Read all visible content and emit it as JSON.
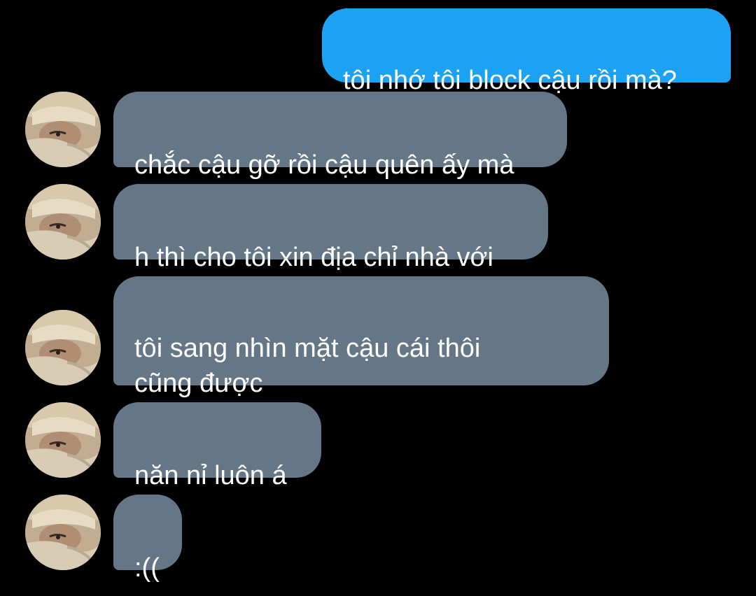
{
  "conversation": {
    "sent_color": "#1da1f2",
    "received_color": "#657786",
    "messages": [
      {
        "sender": "self",
        "text": "tôi nhớ tôi block cậu rồi mà?"
      },
      {
        "sender": "other",
        "text": "chắc cậu gỡ rồi cậu quên ấy mà",
        "avatar": "user-avatar"
      },
      {
        "sender": "other",
        "text": "h thì cho tôi xin địa chỉ nhà với",
        "avatar": "user-avatar"
      },
      {
        "sender": "other",
        "text": "tôi sang nhìn mặt cậu cái thôi\ncũng được",
        "avatar": "user-avatar"
      },
      {
        "sender": "other",
        "text": "năn nỉ luôn á",
        "avatar": "user-avatar"
      },
      {
        "sender": "other",
        "text": ":((",
        "avatar": "user-avatar"
      }
    ]
  }
}
